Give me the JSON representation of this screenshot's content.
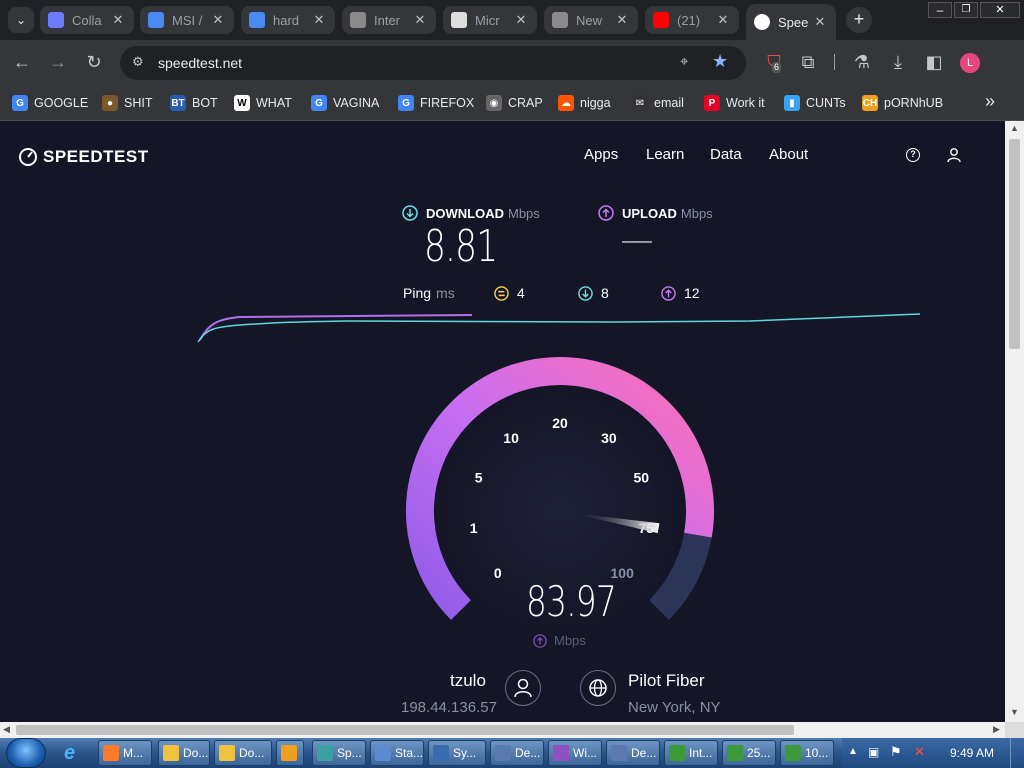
{
  "tabs": [
    {
      "title": "Colla",
      "icon": "search-icon",
      "color": "#6b7cff"
    },
    {
      "title": "MSI /",
      "icon": "msi-icon",
      "color": "#4a8af4"
    },
    {
      "title": "hard",
      "icon": "drive-icon",
      "color": "#4a8af4"
    },
    {
      "title": "Inter",
      "icon": "globe-icon",
      "color": "#8a8a8a"
    },
    {
      "title": "Micr",
      "icon": "building-icon",
      "color": "#dddddd"
    },
    {
      "title": "New",
      "icon": "globe-icon",
      "color": "#8a8a8a"
    },
    {
      "title": "(21)",
      "icon": "youtube-icon",
      "color": "#ff0000"
    },
    {
      "title": "Spee",
      "icon": "speedtest-icon",
      "color": "#ffffff"
    }
  ],
  "address": "speedtest.net",
  "extension_badge": "6",
  "profile_initial": "L",
  "bookmarks": [
    {
      "label": "GOOGLE",
      "icon": "google-icon"
    },
    {
      "label": "SHIT",
      "icon": "shit-icon"
    },
    {
      "label": "BOT",
      "icon": "bot-icon"
    },
    {
      "label": "WHAT",
      "icon": "w-icon"
    },
    {
      "label": "VAGINA",
      "icon": "google-icon"
    },
    {
      "label": "FIREFOX",
      "icon": "google-icon"
    },
    {
      "label": "CRAP",
      "icon": "crap-icon"
    },
    {
      "label": "nigga",
      "icon": "soundcloud-icon"
    },
    {
      "label": "email",
      "icon": "mail-icon"
    },
    {
      "label": "Work it",
      "icon": "pinterest-icon"
    },
    {
      "label": "CUNTs",
      "icon": "bookmark-icon"
    },
    {
      "label": "pORNhUB",
      "icon": "ch-icon"
    }
  ],
  "bookmarks_more": "»",
  "site": {
    "logo": "SPEEDTEST",
    "nav": [
      "Apps",
      "Learn",
      "Data",
      "About"
    ]
  },
  "results": {
    "download_label": "DOWNLOAD",
    "download_unit": "Mbps",
    "download_value": "8.81",
    "upload_label": "UPLOAD",
    "upload_unit": "Mbps",
    "upload_value": "——",
    "ping_label": "Ping",
    "ping_unit": "ms",
    "ping_idle": "4",
    "ping_down": "8",
    "ping_up": "12"
  },
  "gauge": {
    "ticks": [
      "0",
      "1",
      "5",
      "10",
      "20",
      "30",
      "50",
      "75",
      "100"
    ],
    "value": "83.97",
    "unit": "Mbps",
    "needle_fraction": 0.87
  },
  "client": {
    "name": "tzulo",
    "ip": "198.44.136.57"
  },
  "server": {
    "name": "Pilot Fiber",
    "location": "New York, NY"
  },
  "taskbar": {
    "items": [
      "M...",
      "Do...",
      "Do...",
      "",
      "Sp...",
      "Sta...",
      "Sy...",
      "De...",
      "Wi...",
      "De...",
      "Int...",
      "25...",
      "10..."
    ],
    "time": "9:49 AM"
  }
}
